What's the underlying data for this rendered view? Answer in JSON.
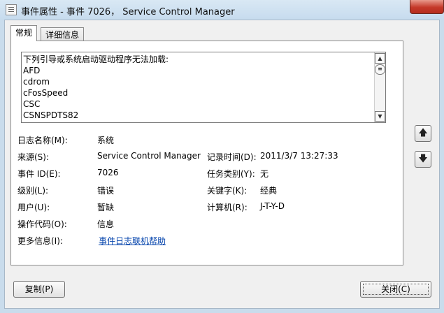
{
  "window": {
    "title": "事件属性 - 事件 7026， Service Control Manager"
  },
  "tabs": [
    {
      "label": "常规",
      "active": true
    },
    {
      "label": "详细信息",
      "active": false
    }
  ],
  "description": {
    "lines": [
      "下列引导或系统启动驱动程序无法加载:",
      "AFD",
      "cdrom",
      "cFosSpeed",
      "CSC",
      "CSNSPDTS82"
    ]
  },
  "fields": {
    "log_name_label": "日志名称(M):",
    "log_name": "系统",
    "source_label": "来源(S):",
    "source": "Service Control Manager",
    "logged_label": "记录时间(D):",
    "logged": "2011/3/7 13:27:33",
    "event_id_label": "事件 ID(E):",
    "event_id": "7026",
    "task_category_label": "任务类别(Y):",
    "task_category": "无",
    "level_label": "级别(L):",
    "level": "错误",
    "keywords_label": "关键字(K):",
    "keywords": "经典",
    "user_label": "用户(U):",
    "user": "暂缺",
    "computer_label": "计算机(R):",
    "computer": "J-T-Y-D",
    "opcode_label": "操作代码(O):",
    "opcode": "信息",
    "more_info_label": "更多信息(I):",
    "more_info_link": "事件日志联机帮助"
  },
  "buttons": {
    "copy": "复制(P)",
    "close": "关闭(C)"
  },
  "icons": {
    "prev_event": "arrow-up-icon",
    "next_event": "arrow-down-icon"
  }
}
